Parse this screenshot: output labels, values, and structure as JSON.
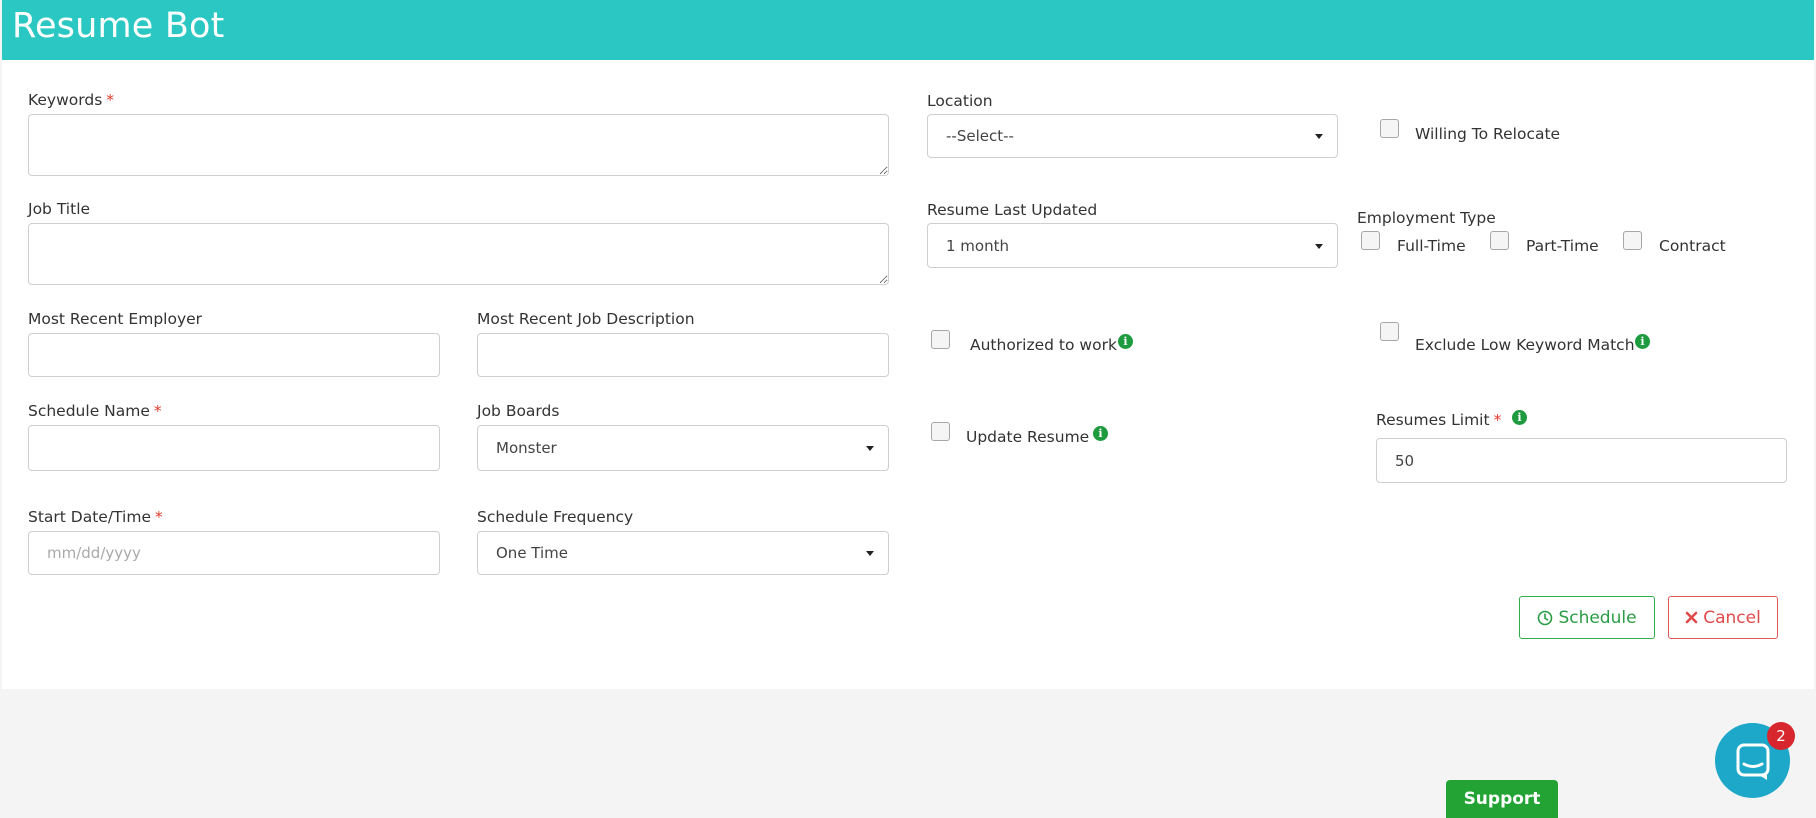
{
  "header": {
    "title": "Resume Bot"
  },
  "form": {
    "keywords": {
      "label": "Keywords",
      "required": "*"
    },
    "job_title": {
      "label": "Job Title"
    },
    "recent_employer": {
      "label": "Most Recent Employer"
    },
    "recent_job_description": {
      "label": "Most Recent Job Description"
    },
    "schedule_name": {
      "label": "Schedule Name",
      "required": "*"
    },
    "job_boards": {
      "label": "Job Boards",
      "value": "Monster"
    },
    "start_date": {
      "label": "Start Date/Time",
      "required": "*",
      "placeholder": "mm/dd/yyyy"
    },
    "schedule_frequency": {
      "label": "Schedule Frequency",
      "value": "One Time"
    },
    "location": {
      "label": "Location",
      "value": "--Select--"
    },
    "willing_to_relocate": {
      "label": "Willing To Relocate"
    },
    "resume_last_updated": {
      "label": "Resume Last Updated",
      "value": "1 month"
    },
    "employment_type": {
      "label": "Employment Type",
      "options": [
        "Full-Time",
        "Part-Time",
        "Contract"
      ]
    },
    "authorized_to_work": {
      "label": "Authorized to work"
    },
    "exclude_low_keyword_match": {
      "label": "Exclude Low Keyword Match"
    },
    "update_resume": {
      "label": "Update Resume"
    },
    "resumes_limit": {
      "label": "Resumes Limit",
      "required": "*",
      "value": "50"
    }
  },
  "info_glyph": "i",
  "actions": {
    "schedule_label": "Schedule",
    "cancel_label": "Cancel"
  },
  "chat": {
    "badge_count": "2"
  },
  "support": {
    "label": "Support"
  },
  "colors": {
    "header": "#2bc8c3",
    "required": "#e0392b",
    "info": "#1f9b3f",
    "schedule": "#2fae4a",
    "cancel": "#e05757",
    "chat": "#1da7c9",
    "support": "#23a334"
  }
}
